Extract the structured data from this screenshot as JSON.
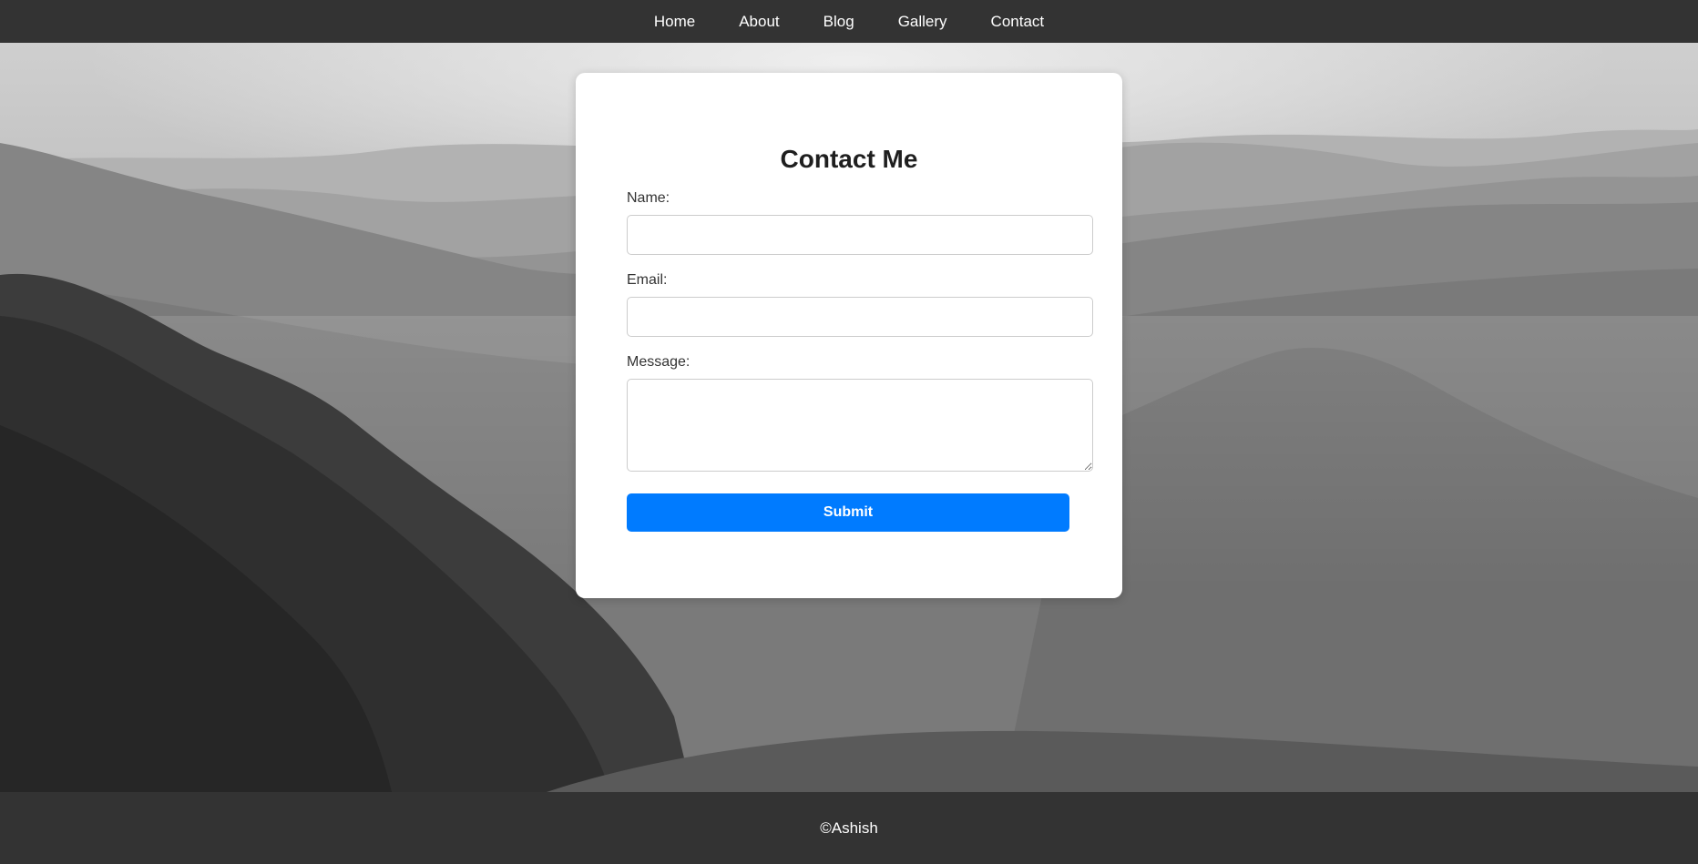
{
  "nav": {
    "items": [
      {
        "label": "Home"
      },
      {
        "label": "About"
      },
      {
        "label": "Blog"
      },
      {
        "label": "Gallery"
      },
      {
        "label": "Contact"
      }
    ]
  },
  "contact_form": {
    "title": "Contact Me",
    "name_label": "Name:",
    "name_value": "",
    "email_label": "Email:",
    "email_value": "",
    "message_label": "Message:",
    "message_value": "",
    "submit_label": "Submit"
  },
  "footer": {
    "text": "©Ashish"
  },
  "colors": {
    "nav_background": "#333333",
    "footer_background": "#333333",
    "card_background": "#ffffff",
    "submit_button": "#007bff",
    "text_dark": "#1f1f1f"
  }
}
